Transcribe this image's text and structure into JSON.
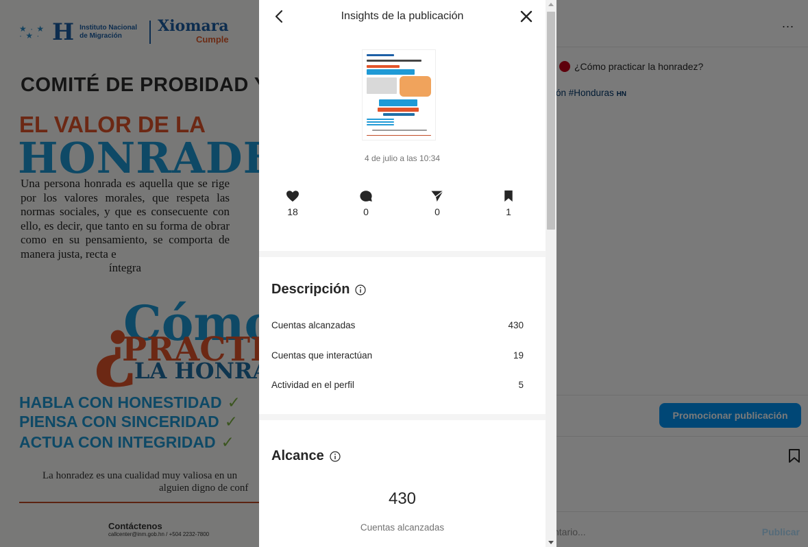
{
  "poster": {
    "logo_stars": "★ · ★\n · ★ ·",
    "logo_h": "H",
    "logo_line1": "Instituto Nacional",
    "logo_line2": "de Migración",
    "logo_xiomara": "Xiomara",
    "logo_cumple": "Cumple",
    "comite": "COMITÉ DE PROBIDAD Y",
    "valor": "EL VALOR DE LA",
    "honradez": "HONRADEZ",
    "parrafo": "Una persona honrada es aquella que se rige por los valores morales, que respeta las normas sociales, y que es consecuente con ello, es decir, que tanto en su forma de obrar como en su pensamiento, se comporta de manera justa, recta e",
    "parrafo_last": "íntegra",
    "como": "Cómo",
    "q_mark": "¿",
    "practicar": "PRACTIC",
    "la_honradez": "LA HONRA",
    "lema": [
      "HABLA CON HONESTIDAD",
      "PIENSA CON SINCERIDAD",
      "ACTUA CON INTEGRIDAD"
    ],
    "check": "✓",
    "footer1": "La honradez es una cualidad muy valiosa en un",
    "footer2": "alguien digno de conf",
    "contact_title": "Contáctenos",
    "contact_sub": "callcenter@inm.gob.hn / +504 2232-7800"
  },
  "post": {
    "more": "...",
    "caption": "¿Cómo practicar la honradez?",
    "hashtags": "ión #Honduras",
    "hashtags_flag": "HN",
    "promote_button": "Promocionar publicación",
    "comment_placeholder": "ntario...",
    "publish": "Publicar"
  },
  "modal": {
    "title": "Insights de la publicación",
    "post_date": "4 de julio a las 10:34",
    "stats": [
      {
        "name": "likes",
        "value": "18"
      },
      {
        "name": "comments",
        "value": "0"
      },
      {
        "name": "shares",
        "value": "0"
      },
      {
        "name": "saves",
        "value": "1"
      }
    ],
    "descripcion": {
      "title": "Descripción",
      "rows": [
        {
          "label": "Cuentas alcanzadas",
          "value": "430"
        },
        {
          "label": "Cuentas que interactúan",
          "value": "19"
        },
        {
          "label": "Actividad en el perfil",
          "value": "5"
        }
      ]
    },
    "alcance": {
      "title": "Alcance",
      "number": "430",
      "label": "Cuentas alcanzadas"
    }
  },
  "icons": {
    "back": "chevron-left-icon",
    "close": "close-icon",
    "like": "heart-icon",
    "comment": "comment-icon",
    "share": "send-icon",
    "save": "bookmark-icon",
    "info": "info-icon"
  },
  "colors": {
    "accent": "#0095f6",
    "text": "#262626",
    "muted": "#737373"
  }
}
